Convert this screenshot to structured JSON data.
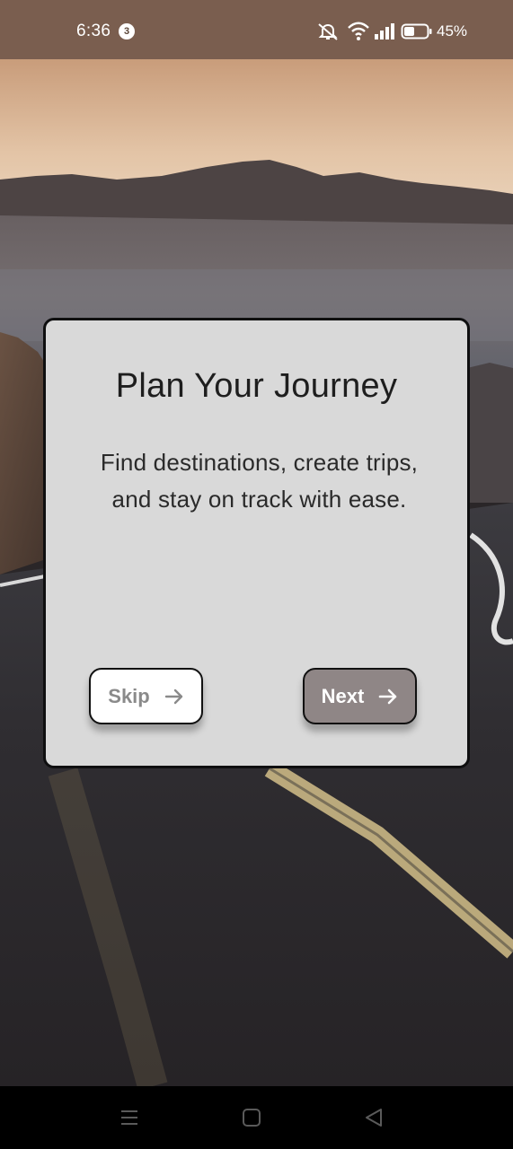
{
  "status_bar": {
    "time": "6:36",
    "notification_count": "3",
    "battery_percent": "45%",
    "icons": [
      "mute-icon",
      "wifi-icon",
      "signal-icon",
      "battery-icon"
    ]
  },
  "onboarding": {
    "title": "Plan Your Journey",
    "description": "Find destinations, create trips, and stay on track with ease.",
    "skip_label": "Skip",
    "next_label": "Next",
    "skip_icon": "arrow-right-icon",
    "next_icon": "arrow-right-icon"
  },
  "navigation_bar": {
    "buttons": [
      "menu-icon",
      "home-square-icon",
      "back-triangle-icon"
    ]
  },
  "colors": {
    "card_background": "#d9d9d9",
    "skip_background": "#ffffff",
    "next_background": "#8f8686",
    "status_bar": "#7a5e4f"
  }
}
